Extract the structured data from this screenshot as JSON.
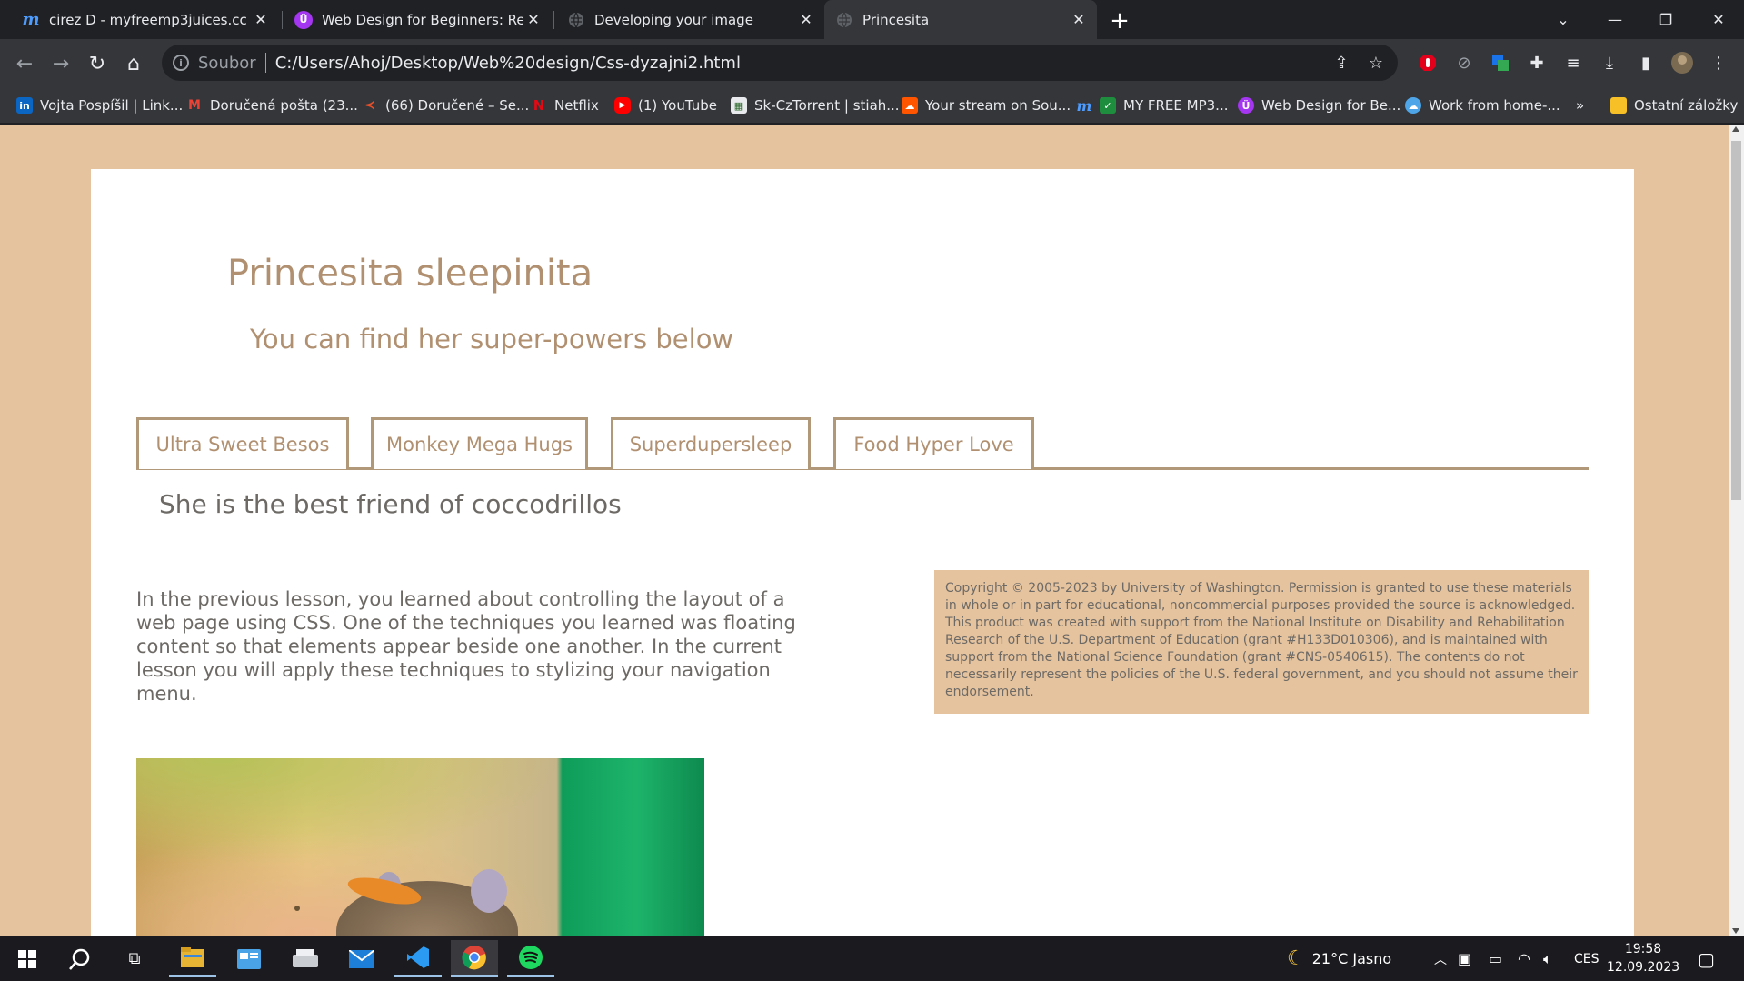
{
  "browser": {
    "tabs": [
      {
        "title": "cirez D - myfreemp3juices.cc",
        "icon": "m-logo-icon"
      },
      {
        "title": "Web Design for Beginners: Real W",
        "icon": "udemy-icon"
      },
      {
        "title": "Developing your image",
        "icon": "globe-icon"
      },
      {
        "title": "Princesita",
        "icon": "globe-icon"
      }
    ],
    "active_tab_index": 3,
    "address": {
      "scheme_label": "Soubor",
      "url": "C:/Users/Ahoj/Desktop/Web%20design/Css-dyzajni2.html"
    },
    "bookmarks": [
      {
        "label": "Vojta Pospíšil | Link...",
        "icon": "linkedin-icon"
      },
      {
        "label": "Doručená pošta (23...",
        "icon": "gmail-icon"
      },
      {
        "label": "(66) Doručené – Se...",
        "icon": "seznam-icon"
      },
      {
        "label": "Netflix",
        "icon": "netflix-icon"
      },
      {
        "label": "(1) YouTube",
        "icon": "youtube-icon"
      },
      {
        "label": "Sk-CzTorrent | stiah...",
        "icon": "torrent-icon"
      },
      {
        "label": "Your stream on Sou...",
        "icon": "soundcloud-icon"
      },
      {
        "label": "MY FREE MP3...",
        "icon": "checkbox-icon"
      },
      {
        "label": "Web Design for Be...",
        "icon": "udemy-icon"
      },
      {
        "label": "Work from home-...",
        "icon": "cloud-icon"
      }
    ],
    "bookmarks_overflow": "»",
    "other_bookmarks": "Ostatní záložky"
  },
  "page": {
    "title": "Princesita sleepinita",
    "subtitle": "You can find her super-powers below",
    "nav": [
      "Ultra Sweet Besos",
      "Monkey Mega Hugs",
      "Superdupersleep",
      "Food Hyper Love"
    ],
    "tagline": "She is the best friend of coccodrillos",
    "lesson_text": "In the previous lesson, you learned about controlling the layout of a web page using CSS. One of the techniques you learned was floating content so that elements appear beside one another. In the current lesson you will apply these techniques to stylizing your navigation menu.",
    "copyright": "Copyright © 2005-2023 by University of Washington. Permission is granted to use these materials in whole or in part for educational, noncommercial purposes provided the source is acknowledged. This product was created with support from the National Institute on Disability and Rehabilitation Research of the U.S. Department of Education (grant #H133D010306), and is maintained with support from the National Science Foundation (grant #CNS-0540615). The contents do not necessarily represent the policies of the U.S. federal government, and you should not assume their endorsement."
  },
  "taskbar": {
    "weather": "21°C Jasno",
    "language": "CES",
    "time": "19:58",
    "date": "12.09.2023"
  },
  "colors": {
    "page_bg": "#e5c39e",
    "accent_text": "#b09070",
    "body_text": "#6d6a66",
    "nav_border": "#b09878"
  }
}
